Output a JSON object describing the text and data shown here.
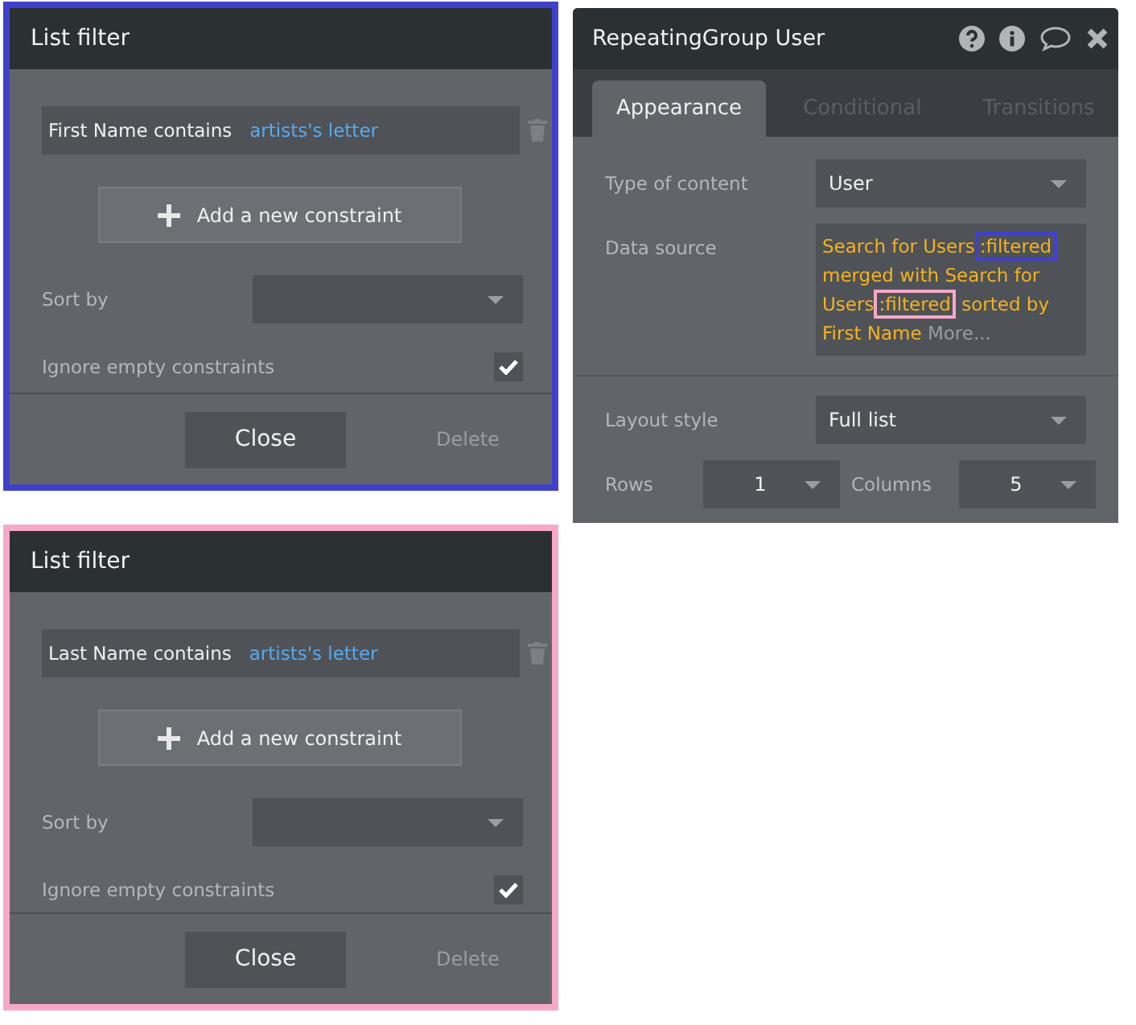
{
  "list_filters": [
    {
      "color": "#4040cc",
      "title": "List filter",
      "constraint": {
        "field": "First Name contains",
        "value": "artists's letter"
      },
      "add_button": "Add a new constraint",
      "sort_label": "Sort by",
      "ignore_label": "Ignore empty constraints",
      "ignore_checked": true,
      "close": "Close",
      "delete": "Delete"
    },
    {
      "color": "#f8a8c8",
      "title": "List filter",
      "constraint": {
        "field": "Last Name contains",
        "value": "artists's letter"
      },
      "add_button": "Add a new constraint",
      "sort_label": "Sort by",
      "ignore_label": "Ignore empty constraints",
      "ignore_checked": true,
      "close": "Close",
      "delete": "Delete"
    }
  ],
  "property_editor": {
    "title": "RepeatingGroup User",
    "tabs": [
      {
        "label": "Appearance",
        "selected": true
      },
      {
        "label": "Conditional",
        "selected": false
      },
      {
        "label": "Transitions",
        "selected": false
      }
    ],
    "type_label": "Type of content",
    "type_value": "User",
    "source_label": "Data source",
    "source_segments": [
      {
        "text": "Search for Users"
      },
      {
        "text": ":filtered",
        "color": "#4040cc"
      },
      {
        "text": " merged with Search for Users"
      },
      {
        "text": ":filtered",
        "color": "#f8a8c8"
      },
      {
        "text": " sorted by First Name"
      }
    ],
    "more": "More...",
    "layout_label": "Layout style",
    "layout_value": "Full list",
    "rows_label": "Rows",
    "rows_value": "1",
    "columns_label": "Columns",
    "columns_value": "5"
  }
}
